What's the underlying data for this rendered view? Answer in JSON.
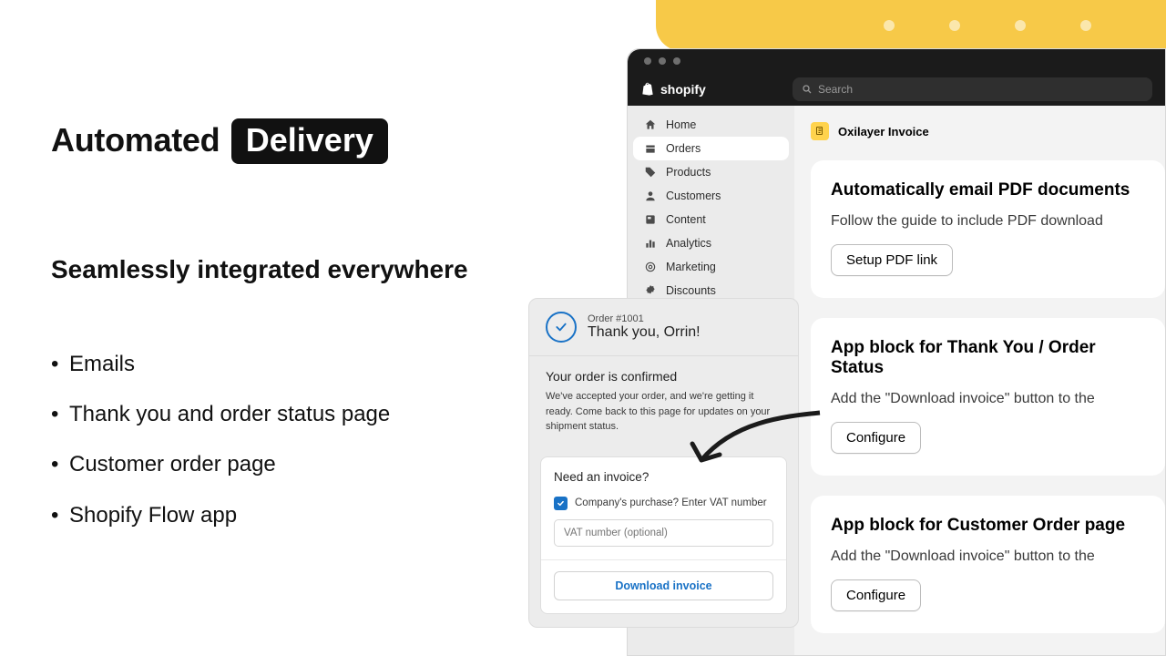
{
  "marketing": {
    "title_plain": "Automated",
    "title_box": "Delivery",
    "subtitle": "Seamlessly integrated everywhere",
    "bullets": [
      "Emails",
      "Thank you and order status page",
      "Customer order page",
      "Shopify Flow app"
    ]
  },
  "window": {
    "brand": "shopify",
    "search_placeholder": "Search",
    "sidebar": {
      "items": [
        {
          "label": "Home",
          "selected": false
        },
        {
          "label": "Orders",
          "selected": true
        },
        {
          "label": "Products",
          "selected": false
        },
        {
          "label": "Customers",
          "selected": false
        },
        {
          "label": "Content",
          "selected": false
        },
        {
          "label": "Analytics",
          "selected": false
        },
        {
          "label": "Marketing",
          "selected": false
        },
        {
          "label": "Discounts",
          "selected": false
        }
      ]
    },
    "app_title": "Oxilayer Invoice",
    "cards": [
      {
        "heading": "Automatically email PDF documents",
        "desc": "Follow the guide to include PDF download",
        "button": "Setup PDF link"
      },
      {
        "heading": "App block for Thank You / Order Status",
        "desc": "Add the \"Download invoice\" button to the",
        "button": "Configure"
      },
      {
        "heading": "App block for Customer Order page",
        "desc": "Add the \"Download invoice\" button to the",
        "button": "Configure"
      }
    ]
  },
  "order_popup": {
    "order_number": "Order #1001",
    "thank_you": "Thank you, Orrin!",
    "confirm_title": "Your order is confirmed",
    "confirm_desc": "We've accepted your order, and we're getting it ready. Come back to this page for updates on your shipment status.",
    "invoice_question": "Need an invoice?",
    "checkbox_label": "Company's purchase? Enter VAT number",
    "vat_placeholder": "VAT number (optional)",
    "download_label": "Download invoice"
  }
}
